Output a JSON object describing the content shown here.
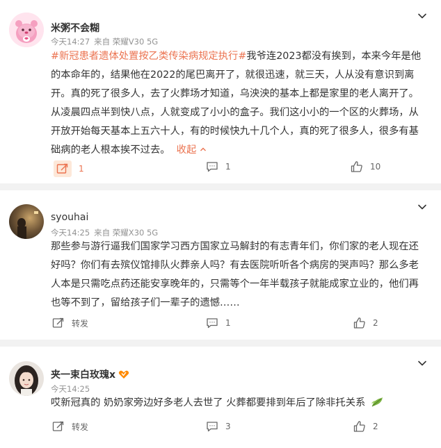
{
  "posts": [
    {
      "author": "米粥不会糊",
      "time": "今天14:27",
      "source": "来自 荣耀V30 5G",
      "hashtag": "#新冠患者遗体处置按乙类传染病规定执行#",
      "body": "我爷连2023都没有挨到，本来今年是他的本命年的，结果他在2022的尾巴离开了，就很迅速，就三天，人从没有意识到离开。真的死了很多人，去了火葬场才知道，乌泱泱的基本上都是家里的老人离开了。从凌晨四点半到快八点，人就变成了小小的盒子。我们这小小的一个区的火葬场，从开放开始每天基本上五六十人，有的时候快九十几个人，真的死了很多人，很多有基础病的老人根本挨不过去。",
      "collapse_label": "收起",
      "repost": "1",
      "comments": "1",
      "likes": "10"
    },
    {
      "author": "syouhai",
      "time": "今天14:25",
      "source": "来自 荣耀X30 5G",
      "body": "那些参与游行逼我们国家学习西方国家立马解封的有志青年们，你们家的老人现在还好吗？你们有去殡仪馆排队火葬亲人吗？有去医院听听各个病房的哭声吗？那么多老人本是只需吃点药还能安享晚年的，只需等个一年半载孩子就能成家立业的，他们再也等不到了，留给孩子们一辈子的遗憾……",
      "repost": "转发",
      "comments": "1",
      "likes": "2"
    },
    {
      "author": "夹一束白玫瑰x",
      "time": "今天14:25",
      "body": "哎新冠真的 奶奶家旁边好多老人去世了 火葬都要排到年后了除非托关系",
      "repost": "转发",
      "comments": "3",
      "likes": "2"
    }
  ],
  "colors": {
    "accent": "#eb7350",
    "meta": "#939393",
    "text": "#333333"
  },
  "icons": [
    "chevron-down-icon",
    "repost-icon",
    "comment-icon",
    "like-icon",
    "membership-badge-icon",
    "leaf-emoji-icon"
  ]
}
